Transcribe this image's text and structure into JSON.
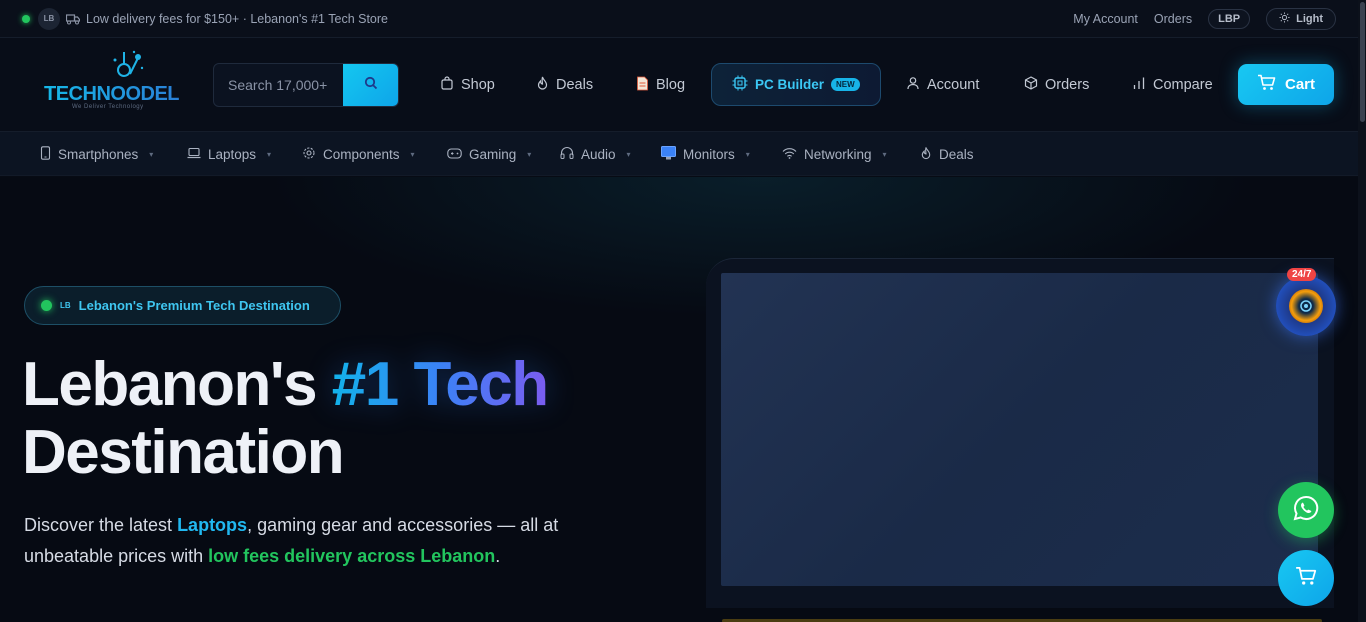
{
  "topbar": {
    "country_chip": "LB",
    "announcement": "Low delivery fees for $150+ · Lebanon's #1 Tech Store",
    "my_account": "My Account",
    "orders": "Orders",
    "currency": "LBP",
    "theme_toggle": "Light"
  },
  "header": {
    "logo_text": "TECHNOODEL",
    "logo_tagline": "We Deliver Technology",
    "search_placeholder": "Search 17,000+",
    "nav": {
      "shop": "Shop",
      "deals": "Deals",
      "blog": "Blog",
      "pc_builder": "PC Builder",
      "pc_builder_badge": "NEW",
      "account": "Account",
      "orders": "Orders",
      "compare": "Compare",
      "cart": "Cart"
    }
  },
  "categories": [
    {
      "label": "Smartphones",
      "icon": "phone-icon"
    },
    {
      "label": "Laptops",
      "icon": "laptop-icon"
    },
    {
      "label": "Components",
      "icon": "gear-icon"
    },
    {
      "label": "Gaming",
      "icon": "gamepad-icon"
    },
    {
      "label": "Audio",
      "icon": "headphones-icon"
    },
    {
      "label": "Monitors",
      "icon": "monitor-icon"
    },
    {
      "label": "Networking",
      "icon": "wifi-icon"
    },
    {
      "label": "Deals",
      "icon": "flame-icon"
    }
  ],
  "hero": {
    "badge_flag": "LB",
    "badge_text": "Lebanon's Premium Tech Destination",
    "title_part1": "Lebanon's ",
    "title_accent": "#1 Tech",
    "title_line2": "Destination",
    "lead_part1": "Discover the latest ",
    "lead_laptops": "Laptops",
    "lead_part2": ", gaming gear and accessories — all at unbeatable prices with ",
    "lead_delivery": "low fees delivery across Lebanon",
    "lead_end": "."
  },
  "floating": {
    "support_badge": "24/7"
  },
  "colors": {
    "accent": "#0ea5e9",
    "green": "#22c55e",
    "background": "#060a13"
  }
}
